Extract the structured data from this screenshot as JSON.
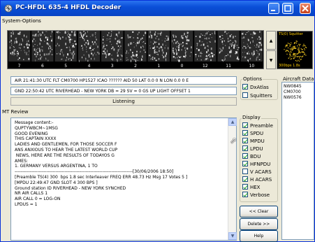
{
  "window": {
    "title": "PC-HFDL 635-4 HFDL Decoder"
  },
  "menu": {
    "system_options": "System-Options"
  },
  "spectrum": {
    "channel_labels": [
      "7",
      "6",
      "5",
      "4",
      "3",
      "2",
      "1",
      "0",
      "12",
      "11",
      "10"
    ]
  },
  "squitter": {
    "label": "TS(0) Squitter",
    "rate": "300bps 1.8s"
  },
  "info": {
    "line1": "AIR 21:41:30 UTC FLT CM0700  HP1527 ICAO ??????  AID 50 LAT 0.0 0  N  LON 0.0 0  E",
    "line2": "GND 22:50:42 UTC RIVERHEAD - NEW YORK  DB = 29  SV = 0  GS UP LIGHT  OFFSET 1",
    "status": "Listening"
  },
  "options": {
    "label": "Options",
    "items": [
      {
        "label": "DxAtlas",
        "checked": true
      },
      {
        "label": "Squitters",
        "checked": false
      }
    ]
  },
  "aircraft_data": {
    "label": "Aircraft Data",
    "items": [
      "NW0845",
      "CM0700",
      "NW0576"
    ]
  },
  "review": {
    "label": "MT Review",
    "lines": [
      "Message content:-",
      "QUPTYWBCM~1MSG",
      "",
      "GOOD EVENING",
      "THIS CAPTAIN XXXX",
      "LADIES AND GENTLEMEN, FOR THOSE SOCCER F",
      "ANS ANXIOUS TO HEAR THE LATEST WORLD CUP",
      " NEWS, HERE ARE THE RESULTS OF TODAYÕS G",
      "AMES:",
      "1. GERMANY VERSUS ARGENTINA, 1 TO",
      "------------------------------------------------------------------------------[30/06/2006 18:50]",
      "[Preamble TS(4) 300  bps 1.8 sec Interleaver FREQ ERR 48.73 Hz Msg 17 Votes 5 ]",
      "",
      "[MPDU 22:49:47 GND SLOT 4 300 BPS ]",
      "Ground station ID RIVERHEAD - NEW YORK SYNCHED",
      "NR AIR CALLS 1",
      "AIR CALL 0 = LOG-ON",
      "LPDUS = 1"
    ]
  },
  "display": {
    "label": "Display",
    "items": [
      {
        "label": "Preamble",
        "checked": true
      },
      {
        "label": "SPDU",
        "checked": true
      },
      {
        "label": "MPDU",
        "checked": true
      },
      {
        "label": "LPDU",
        "checked": true
      },
      {
        "label": "BDU",
        "checked": true
      },
      {
        "label": "HFNPDU",
        "checked": true
      },
      {
        "label": "V ACARS",
        "checked": false
      },
      {
        "label": "H ACARS",
        "checked": true
      },
      {
        "label": "HEX",
        "checked": true
      },
      {
        "label": "Verbose",
        "checked": true
      }
    ]
  },
  "buttons": {
    "clear": "<< Clear",
    "delete": "Delete >>",
    "help": "Help"
  },
  "colors": {
    "titlebar": "#0a4fd8",
    "squitter_text": "#ffcc00",
    "squitter_dots": "#e8c020",
    "check": "#21a121"
  }
}
